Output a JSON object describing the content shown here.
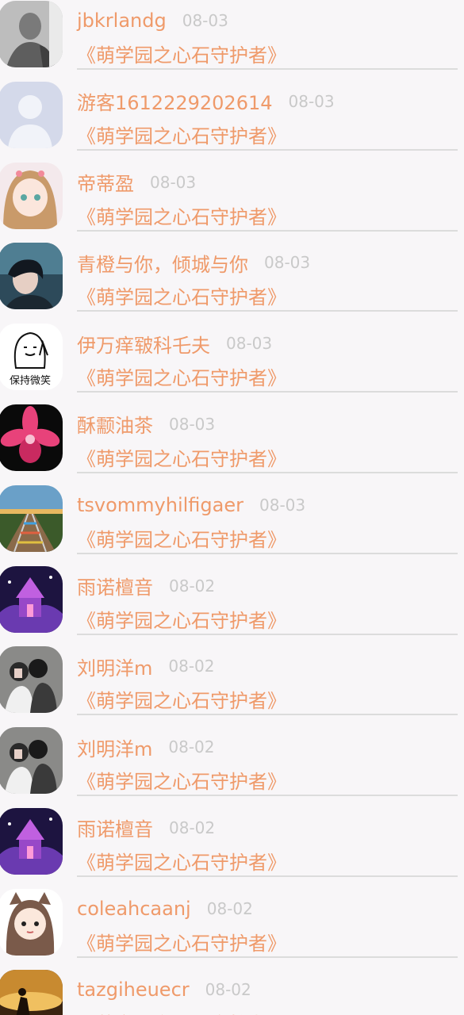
{
  "colors": {
    "accent": "#ef9a6a",
    "date": "#c9c9c9",
    "background": "#f8f6f8",
    "divider": "#dcdcdc"
  },
  "items": [
    {
      "name": "jbkrlandg",
      "date": "08-03",
      "work": "《萌学园之心石守护者》",
      "avatar_icon": "tattooed-man-photo-avatar"
    },
    {
      "name": "游客1612229202614",
      "date": "08-03",
      "work": "《萌学园之心石守护者》",
      "avatar_icon": "default-user-avatar"
    },
    {
      "name": "帝蒂盈",
      "date": "08-03",
      "work": "《萌学园之心石守护者》",
      "avatar_icon": "anime-girl-avatar"
    },
    {
      "name": "青橙与你，倾城与你",
      "date": "08-03",
      "work": "《萌学园之心石守护者》",
      "avatar_icon": "dark-portrait-avatar"
    },
    {
      "name": "伊万痒皲科乇夫",
      "date": "08-03",
      "work": "《萌学园之心石守护者》",
      "avatar_icon": "smile-sketch-avatar"
    },
    {
      "name": "酥颥油茶",
      "date": "08-03",
      "work": "《萌学园之心石守护者》",
      "avatar_icon": "pink-orchid-avatar"
    },
    {
      "name": "tsvommyhilfigaer",
      "date": "08-03",
      "work": "《萌学园之心石守护者》",
      "avatar_icon": "railway-track-avatar"
    },
    {
      "name": "雨诺檀音",
      "date": "08-02",
      "work": "《萌学园之心石守护者》",
      "avatar_icon": "purple-castle-avatar"
    },
    {
      "name": "刘明洋m",
      "date": "08-02",
      "work": "《萌学园之心石守护者》",
      "avatar_icon": "couple-photo-avatar"
    },
    {
      "name": "刘明洋m",
      "date": "08-02",
      "work": "《萌学园之心石守护者》",
      "avatar_icon": "couple-photo-avatar"
    },
    {
      "name": "雨诺檀音",
      "date": "08-02",
      "work": "《萌学园之心石守护者》",
      "avatar_icon": "purple-castle-avatar"
    },
    {
      "name": "coleahcaanj",
      "date": "08-02",
      "work": "《萌学园之心石守护者》",
      "avatar_icon": "cat-hood-girl-avatar"
    },
    {
      "name": "tazgiheuecr",
      "date": "08-02",
      "work": "《萌学园之心石守护者》",
      "avatar_icon": "sunset-silhouette-avatar"
    }
  ],
  "avatar_labels": {
    "smile": "保持微笑"
  }
}
